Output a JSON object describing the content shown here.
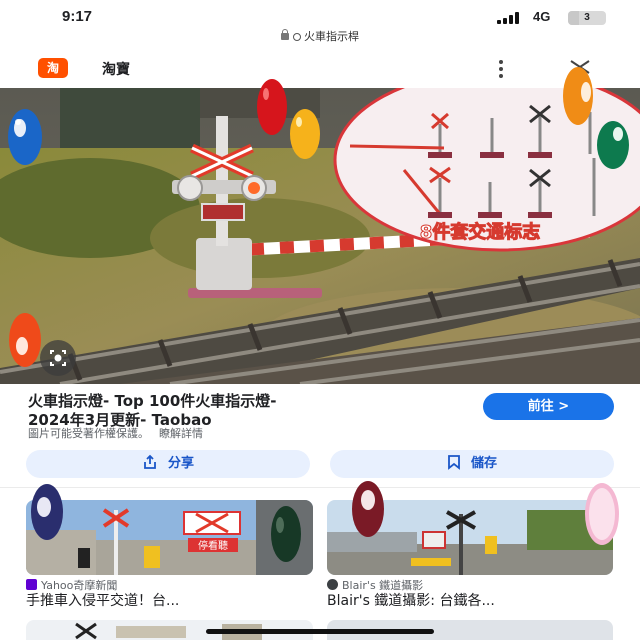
{
  "status_bar": {
    "time": "9:17",
    "network": "4G",
    "battery": "3"
  },
  "url_bar": {
    "query": "火車指示桿"
  },
  "site": {
    "logo": "淘",
    "name": "淘寶",
    "brand_color": "#ff5000"
  },
  "hero": {
    "caption": "8件套交通标志"
  },
  "result": {
    "title_line1": "火車指示燈- Top 100件火車指示燈-",
    "title_line2": "2024年3月更新- Taobao",
    "visit_label": "前往 >",
    "copyright": "圖片可能受著作權保護。",
    "learn_more": "瞭解詳情"
  },
  "actions": {
    "share_label": "分享",
    "save_label": "儲存"
  },
  "related": [
    {
      "source": "Yahoo奇摩新聞",
      "title": "手推車入侵平交道！台...",
      "image_sign": "停看聽"
    },
    {
      "source": "Blair's 鐵道攝影",
      "title": "Blair's 鐵道攝影: 台鐵各..."
    }
  ],
  "colors": {
    "accent": "#1a73e8",
    "pill_bg": "#e8f0fe"
  }
}
